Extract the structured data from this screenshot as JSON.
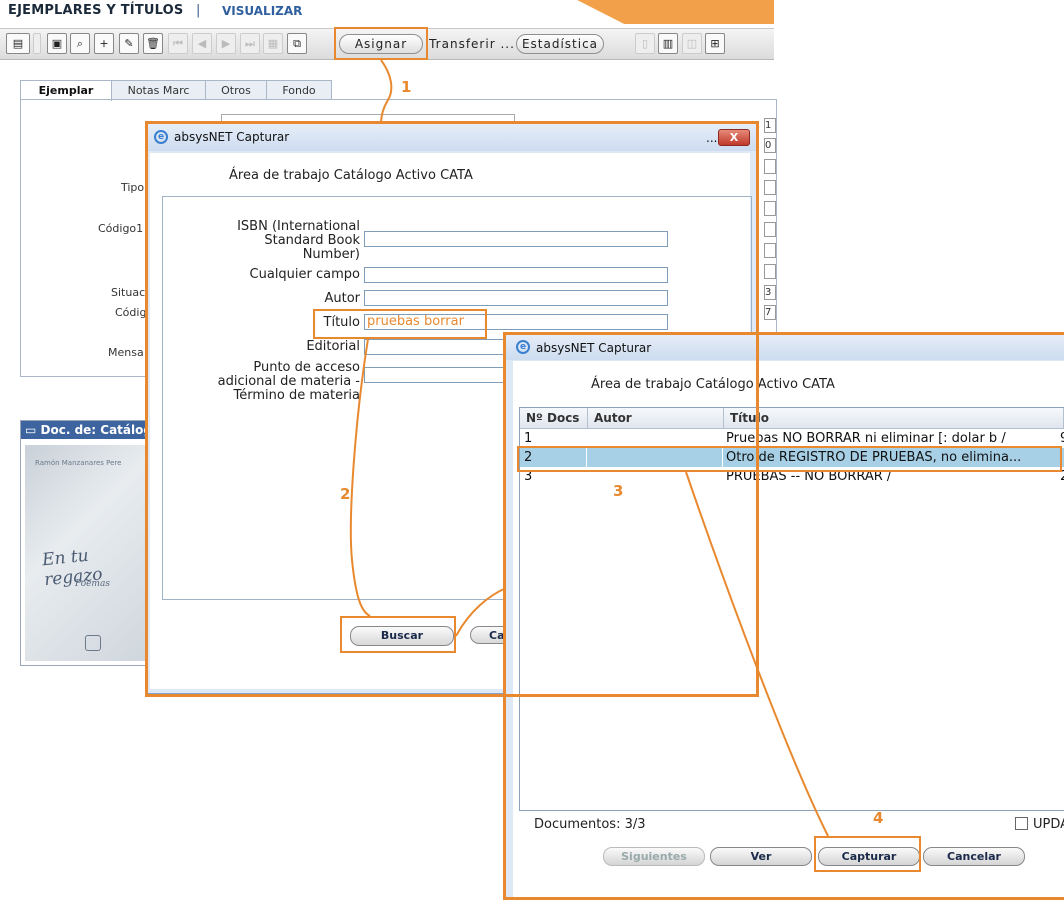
{
  "header": {
    "title": "EJEMPLARES Y TÍTULOS",
    "separator": "|",
    "view_link": "VISUALIZAR"
  },
  "toolbar": {
    "assign_label": "Asignar",
    "transfer_label": "Transferir ...",
    "stats_label": "Estadística"
  },
  "background_form": {
    "tabs": [
      "Ejemplar",
      "Notas Marc",
      "Otros",
      "Fondo"
    ],
    "labels": {
      "tipo": "Tipo",
      "codigo1": "Código1",
      "situacion": "Situac",
      "codigo": "Códig",
      "mensaje": "Mensa"
    },
    "right_values": [
      "1",
      "0",
      "3",
      "7"
    ],
    "doc_panel_title": "Doc. de: Catálog",
    "book_text": {
      "author": "Ramón Manzanares Pere",
      "title": "En tu regazo",
      "subtitle": "Poemas"
    }
  },
  "capture_dialog": {
    "title": "absysNET Capturar",
    "minimize": "...",
    "close": "X",
    "area_prefix": "Área de trabajo",
    "area_value": "Catálogo Activo CATA",
    "fields": {
      "isbn_label": "ISBN (International Standard Book Number)",
      "isbn_line1": "ISBN (International",
      "isbn_line2": "Standard Book",
      "isbn_line3": "Number)",
      "any_label": "Cualquier campo",
      "author_label": "Autor",
      "title_label": "Título",
      "title_value": "pruebas borrar",
      "editorial_label": "Editorial",
      "subject_line1": "Punto de acceso",
      "subject_line2": "adicional de materia -",
      "subject_line3": "Término de materia"
    },
    "search_label": "Buscar",
    "cancel_partial": "Ca"
  },
  "results_dialog": {
    "title": "absysNET Capturar",
    "area_prefix": "Área de trabajo",
    "area_value": "Catálogo Activo CATA",
    "columns": [
      "Nº Docs",
      "Autor",
      "Título"
    ],
    "rows": [
      {
        "num": "1",
        "author": "",
        "title": "Pruebas NO  BORRAR ni eliminar [: dolar b /",
        "extra": "9"
      },
      {
        "num": "2",
        "author": "",
        "title": "Otro de REGISTRO DE PRUEBAS, no elimina...",
        "extra": ""
      },
      {
        "num": "3",
        "author": "",
        "title": "PRUEBAS -- NO BORRAR /",
        "extra": "2"
      }
    ],
    "selected_row": 2,
    "docs_count": "Documentos: 3/3",
    "update_label": "UPDA",
    "buttons": {
      "next": "Siguientes",
      "view": "Ver",
      "capture": "Capturar",
      "cancel": "Cancelar"
    }
  },
  "annotations": {
    "step1": "1",
    "step2": "2",
    "step3": "3",
    "step4": "4",
    "color": "#e8892f"
  }
}
